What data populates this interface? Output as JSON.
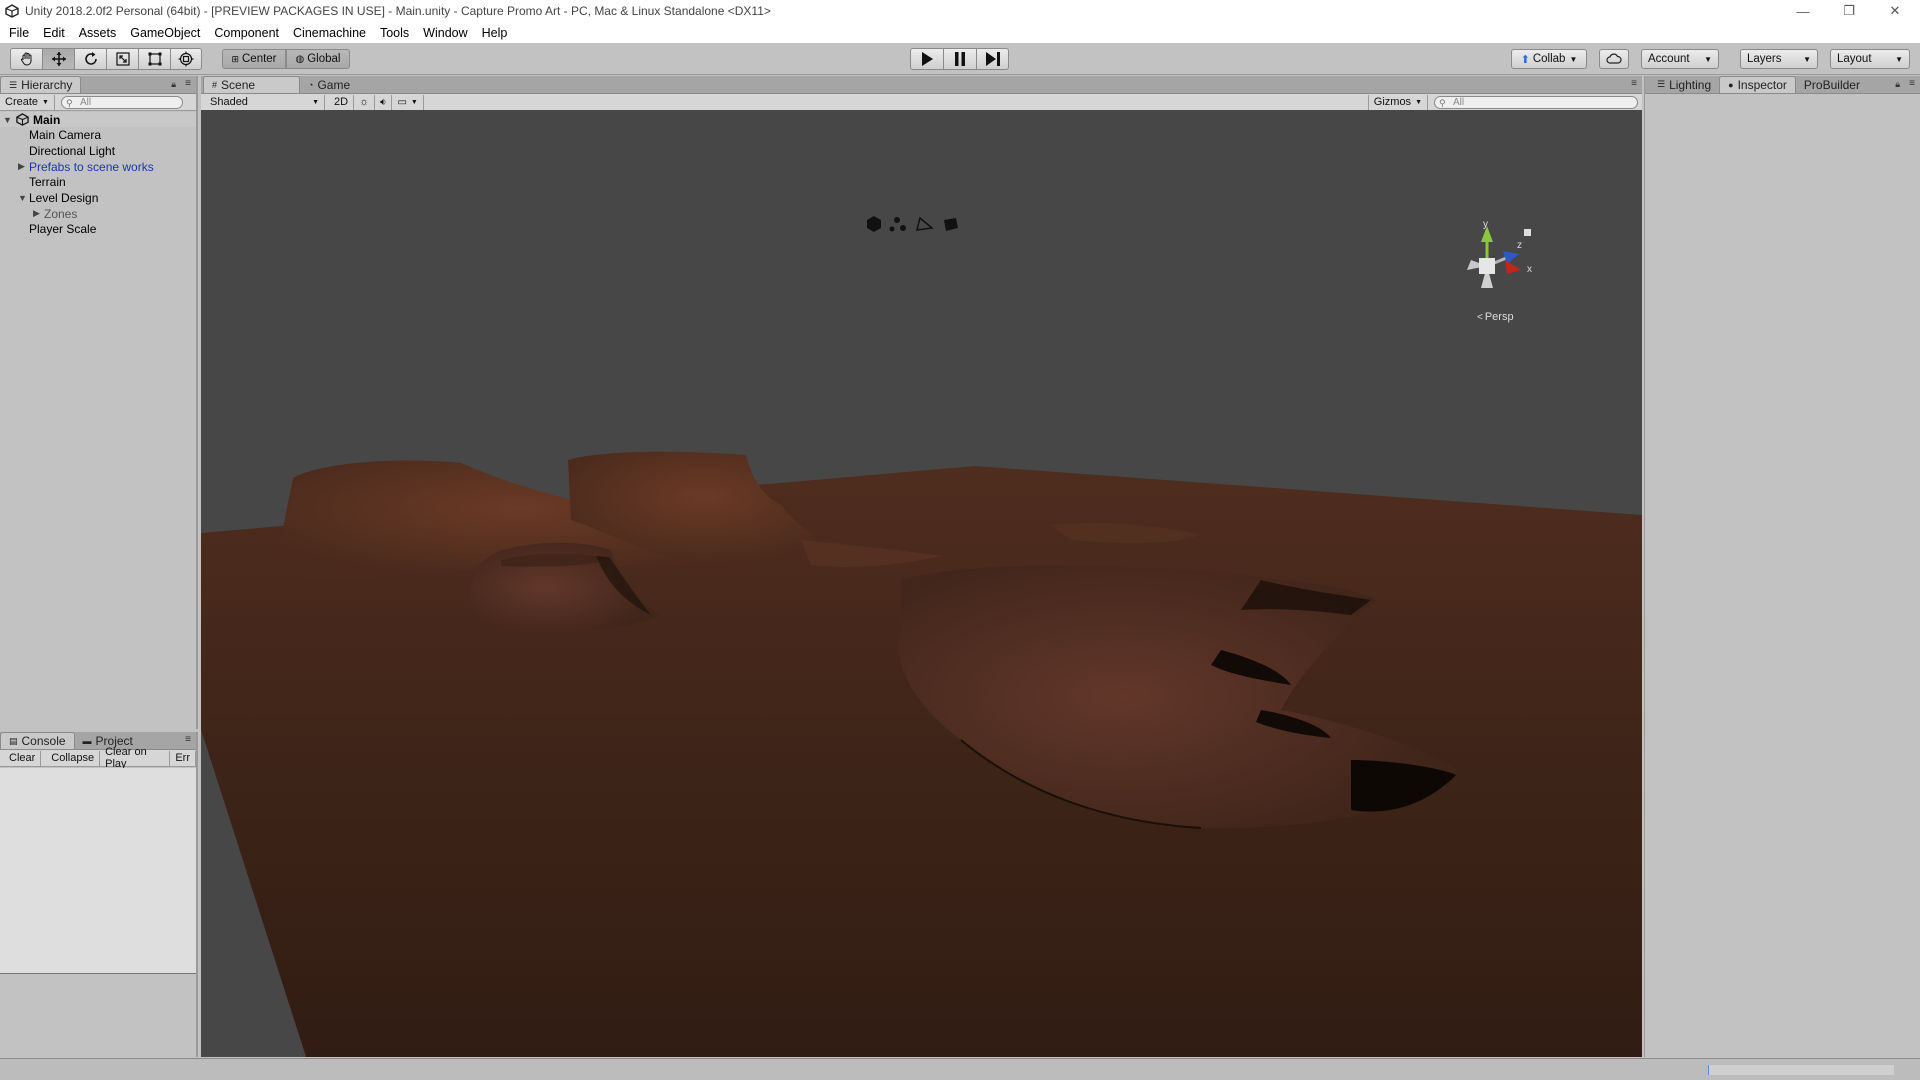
{
  "window": {
    "title": "Unity 2018.2.0f2 Personal (64bit) - [PREVIEW PACKAGES IN USE] - Main.unity - Capture Promo Art - PC, Mac & Linux Standalone <DX11>",
    "minimize": "—",
    "maximize": "❐",
    "close": "✕"
  },
  "menu": [
    "File",
    "Edit",
    "Assets",
    "GameObject",
    "Component",
    "Cinemachine",
    "Tools",
    "Window",
    "Help"
  ],
  "toolbar": {
    "tools": [
      "hand-tool",
      "move-tool",
      "rotate-tool",
      "scale-tool",
      "rect-tool",
      "transform-tool"
    ],
    "active_tool": "move-tool",
    "pivot_label": "Center",
    "space_label": "Global",
    "collab_label": "Collab",
    "account_label": "Account",
    "layers_label": "Layers",
    "layout_label": "Layout"
  },
  "hierarchy": {
    "tab_label": "Hierarchy",
    "create_label": "Create",
    "search_placeholder": "All",
    "scene_name": "Main",
    "items": [
      {
        "label": "Main Camera",
        "indent": 1,
        "arrow": "",
        "prefab": false
      },
      {
        "label": "Directional Light",
        "indent": 1,
        "arrow": "",
        "prefab": false
      },
      {
        "label": "Prefabs to scene works",
        "indent": 1,
        "arrow": "▶",
        "prefab": true
      },
      {
        "label": "Terrain",
        "indent": 1,
        "arrow": "",
        "prefab": false
      },
      {
        "label": "Level Design",
        "indent": 1,
        "arrow": "▼",
        "prefab": false
      },
      {
        "label": "Zones",
        "indent": 2,
        "arrow": "▶",
        "prefab": false,
        "dim": true
      },
      {
        "label": "Player Scale",
        "indent": 1,
        "arrow": "",
        "prefab": false
      }
    ]
  },
  "console": {
    "tabs": [
      "Console",
      "Project"
    ],
    "active_tab": "Console",
    "buttons": [
      "Clear",
      "Collapse",
      "Clear on Play",
      "Err"
    ]
  },
  "scene_view": {
    "tabs": [
      "Scene",
      "Game"
    ],
    "active_tab": "Scene",
    "draw_mode": "Shaded",
    "mode_2d": "2D",
    "gizmos_label": "Gizmos",
    "search_placeholder": "All",
    "persp_label": "Persp",
    "axis_labels": {
      "y": "y",
      "z": "z",
      "x": "x"
    }
  },
  "inspector": {
    "tabs": [
      "Lighting",
      "Inspector",
      "ProBuilder"
    ],
    "active_tab": "Inspector"
  },
  "colors": {
    "prefab_text": "#1a3aa8",
    "terrain": "#4a2a1e",
    "sky": "#474747"
  }
}
